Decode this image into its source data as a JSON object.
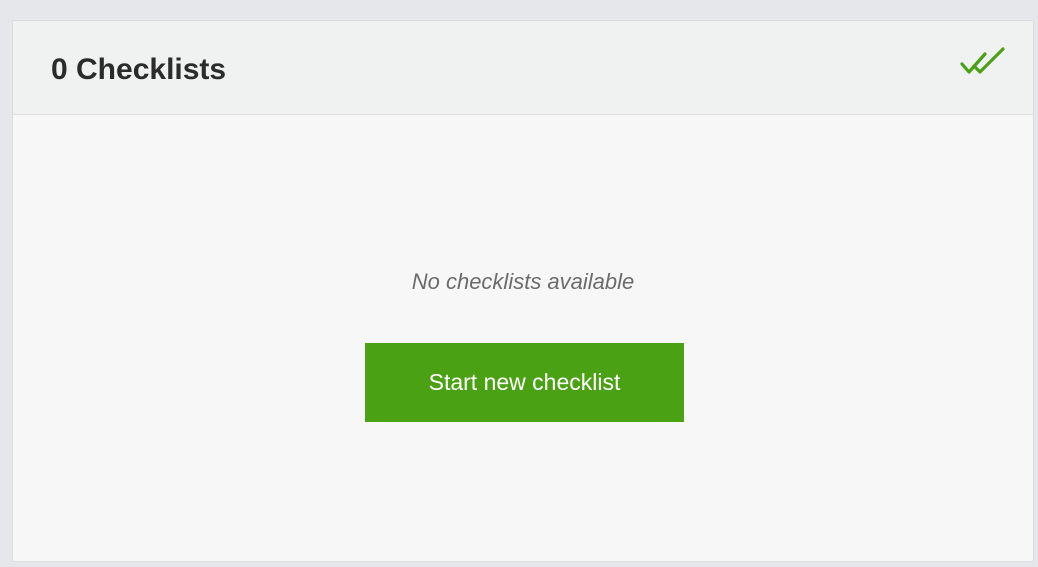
{
  "card": {
    "title": "0 Checklists",
    "header_icon": "double-check-icon",
    "empty_message": "No checklists available",
    "primary_button_label": "Start new checklist"
  },
  "colors": {
    "accent": "#4aa114",
    "page_background": "#e6e7ea",
    "card_background": "#f7f7f7",
    "header_background": "#f0f1f1"
  }
}
